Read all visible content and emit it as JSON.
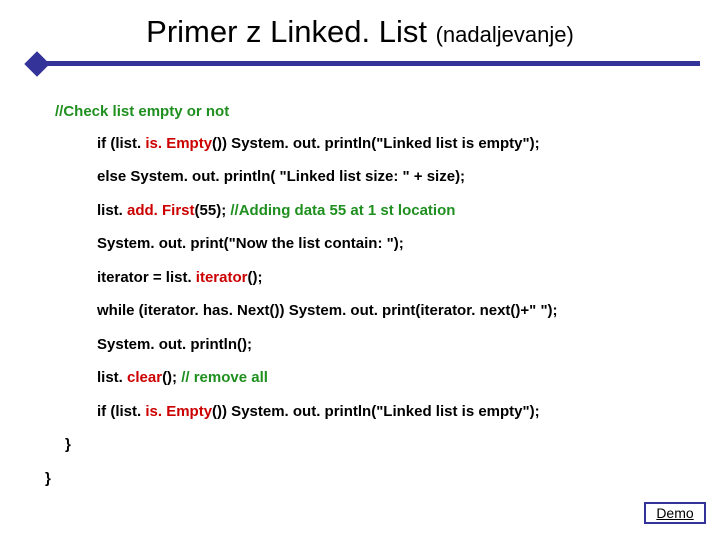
{
  "title": {
    "main": "Primer z Linked. List ",
    "sub": "(nadaljevanje)"
  },
  "commentHead": "//Check list empty or not",
  "lines": {
    "l1a": "if (list. ",
    "l1b": "is. Empty",
    "l1c": "()) System. out. println(\"Linked list is empty\");",
    "l2": "else System. out. println( \"Linked list size: \" + size);",
    "l3a": "list. ",
    "l3b": "add. First",
    "l3c": "(55);  ",
    "l3d": "//Adding data 55 at 1 st location",
    "l4": "System. out. print(\"Now the list contain: \");",
    "l5a": "iterator = list. ",
    "l5b": "iterator",
    "l5c": "();",
    "l6": "while (iterator. has. Next())   System. out. print(iterator. next()+\" \");",
    "l7": "System. out. println();",
    "l8a": "list. ",
    "l8b": "clear",
    "l8c": "(); ",
    "l8d": "// remove all",
    "l9a": "if (list. ",
    "l9b": "is. Empty",
    "l9c": "())   System. out. println(\"Linked list is empty\");"
  },
  "close1": "}",
  "close2": "}",
  "demo": "Demo"
}
